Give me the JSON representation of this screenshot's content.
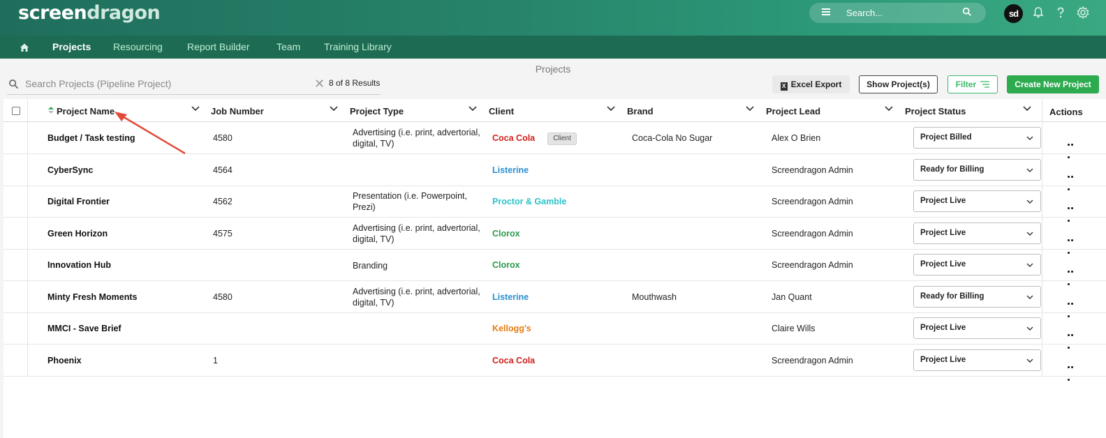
{
  "app": {
    "logo_part1": "screen",
    "logo_part2": "dragon",
    "search_placeholder": "Search...",
    "avatar_initials": "sd"
  },
  "nav": {
    "items": [
      "Projects",
      "Resourcing",
      "Report Builder",
      "Team",
      "Training Library"
    ],
    "active": "Projects"
  },
  "page": {
    "title": "Projects",
    "search_placeholder": "Search  Projects (Pipeline Project)",
    "results": "8 of 8 Results"
  },
  "toolbar": {
    "excel_export": "Excel Export",
    "show_projects": "Show Project(s)",
    "filter": "Filter",
    "create_new": "Create New Project"
  },
  "table": {
    "headers": {
      "project_name": "Project Name",
      "job_number": "Job Number",
      "project_type": "Project Type",
      "client": "Client",
      "brand": "Brand",
      "project_lead": "Project Lead",
      "project_status": "Project Status",
      "actions": "Actions"
    },
    "rows": [
      {
        "name": "Budget / Task testing",
        "job": "4580",
        "type": "Advertising (i.e. print, advertorial, digital, TV)",
        "client": "Coca Cola",
        "client_color": "#d0201b",
        "brand": "Coca-Cola No Sugar",
        "lead": "Alex O Brien",
        "status": "Project Billed"
      },
      {
        "name": "CyberSync",
        "job": "4564",
        "type": "",
        "client": "Listerine",
        "client_color": "#2a8fd0",
        "brand": "",
        "lead": "Screendragon Admin",
        "status": "Ready for Billing"
      },
      {
        "name": "Digital Frontier",
        "job": "4562",
        "type": "Presentation (i.e. Powerpoint, Prezi)",
        "client": "Proctor & Gamble",
        "client_color": "#2cc3c9",
        "brand": "",
        "lead": "Screendragon Admin",
        "status": "Project Live"
      },
      {
        "name": "Green Horizon",
        "job": "4575",
        "type": "Advertising (i.e. print, advertorial, digital, TV)",
        "client": "Clorox",
        "client_color": "#2a9a4a",
        "brand": "",
        "lead": "Screendragon Admin",
        "status": "Project Live"
      },
      {
        "name": "Innovation Hub",
        "job": "",
        "type": "Branding",
        "client": "Clorox",
        "client_color": "#2a9a4a",
        "brand": "",
        "lead": "Screendragon Admin",
        "status": "Project Live"
      },
      {
        "name": "Minty Fresh Moments",
        "job": "4580",
        "type": "Advertising (i.e. print, advertorial, digital, TV)",
        "client": "Listerine",
        "client_color": "#2a8fd0",
        "brand": "Mouthwash",
        "lead": "Jan Quant",
        "status": "Ready for Billing"
      },
      {
        "name": "MMCI - Save Brief",
        "job": "",
        "type": "",
        "client": "Kellogg's",
        "client_color": "#e87c12",
        "brand": "",
        "lead": "Claire Wills",
        "status": "Project Live"
      },
      {
        "name": "Phoenix",
        "job": "1",
        "type": "",
        "client": "Coca Cola",
        "client_color": "#d0201b",
        "brand": "",
        "lead": "Screendragon Admin",
        "status": "Project Live"
      }
    ]
  },
  "tooltip": "Client",
  "colors": {
    "header_gradient_start": "#1f6e5c",
    "nav_bg": "#1d6b53",
    "create_button": "#2eab4f",
    "annotation_arrow": "#e24a3b"
  }
}
